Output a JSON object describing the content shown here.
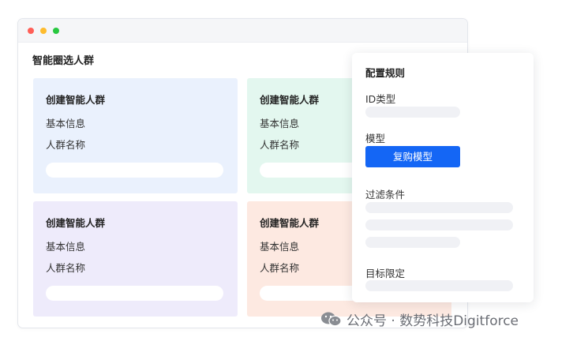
{
  "page": {
    "title": "智能圈选人群"
  },
  "cards": [
    {
      "title": "创建智能人群",
      "line1": "基本信息",
      "line2": "人群名称",
      "color": "#eaf1fd"
    },
    {
      "title": "创建智能人群",
      "line1": "基本信息",
      "line2": "人群名称",
      "color": "#e3f7ef"
    },
    {
      "title": "创建智能人群",
      "line1": "基本信息",
      "line2": "人群名称",
      "color": "#eeebfb"
    },
    {
      "title": "创建智能人群",
      "line1": "基本信息",
      "line2": "人群名称",
      "color": "#fde9e1"
    }
  ],
  "panel": {
    "title": "配置规则",
    "id_type_label": "ID类型",
    "model_label": "模型",
    "model_button": "复购模型",
    "filter_label": "过滤条件",
    "target_label": "目标限定"
  },
  "watermark": {
    "text": "公众号 · 数势科技Digitforce",
    "icon": "wechat-icon"
  },
  "colors": {
    "primary": "#1466f5",
    "window_controls": [
      "#ff5f57",
      "#febc2e",
      "#28c840"
    ]
  }
}
